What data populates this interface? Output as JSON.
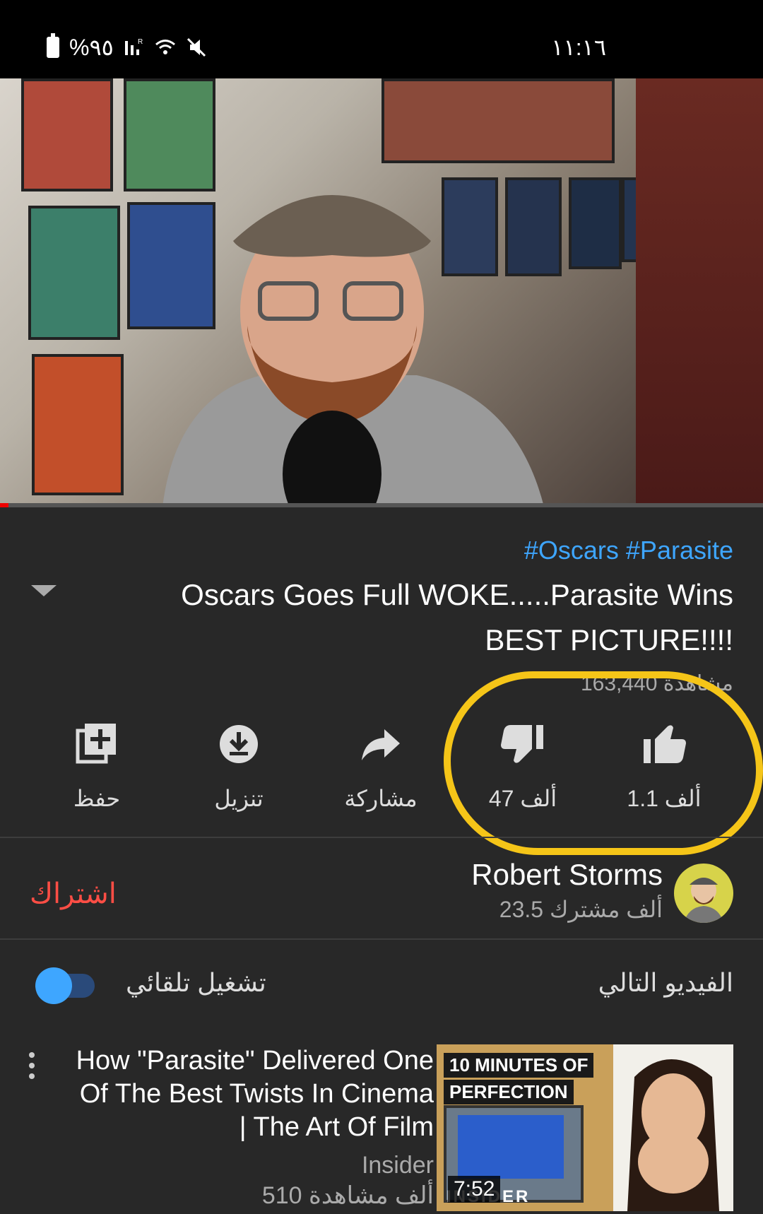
{
  "status_bar": {
    "battery": "%٩٥",
    "time": "١١:١٦"
  },
  "video": {
    "hashtags": "#Oscars #Parasite",
    "title": "Oscars Goes Full WOKE.....Parasite Wins BEST PICTURE!!!!",
    "views": "163,440 مشاهدة"
  },
  "actions": {
    "like_count": "1.1 ألف",
    "dislike_count": "47 ألف",
    "share_label": "مشاركة",
    "download_label": "تنزيل",
    "save_label": "حفظ"
  },
  "channel": {
    "name": "Robert Storms",
    "subscribers": "23.5 ألف مشترك",
    "subscribe_label": "اشتراك"
  },
  "up_next": {
    "label": "الفيديو التالي",
    "autoplay_label": "تشغيل تلقائي",
    "autoplay_on": true
  },
  "next_video": {
    "title": "How \"Parasite\" Delivered One Of The Best Twists In Cinema | The Art Of Film",
    "channel": "Insider",
    "views": "510 ألف مشاهدة",
    "duration": "7:52",
    "thumb_tag_1": "10 MINUTES OF",
    "thumb_tag_2": "PERFECTION",
    "thumb_brand": "INSIDER"
  },
  "colors": {
    "accent_blue": "#3ea6ff",
    "subscribe_red": "#ff4e45",
    "highlight_yellow": "#f5c518"
  }
}
